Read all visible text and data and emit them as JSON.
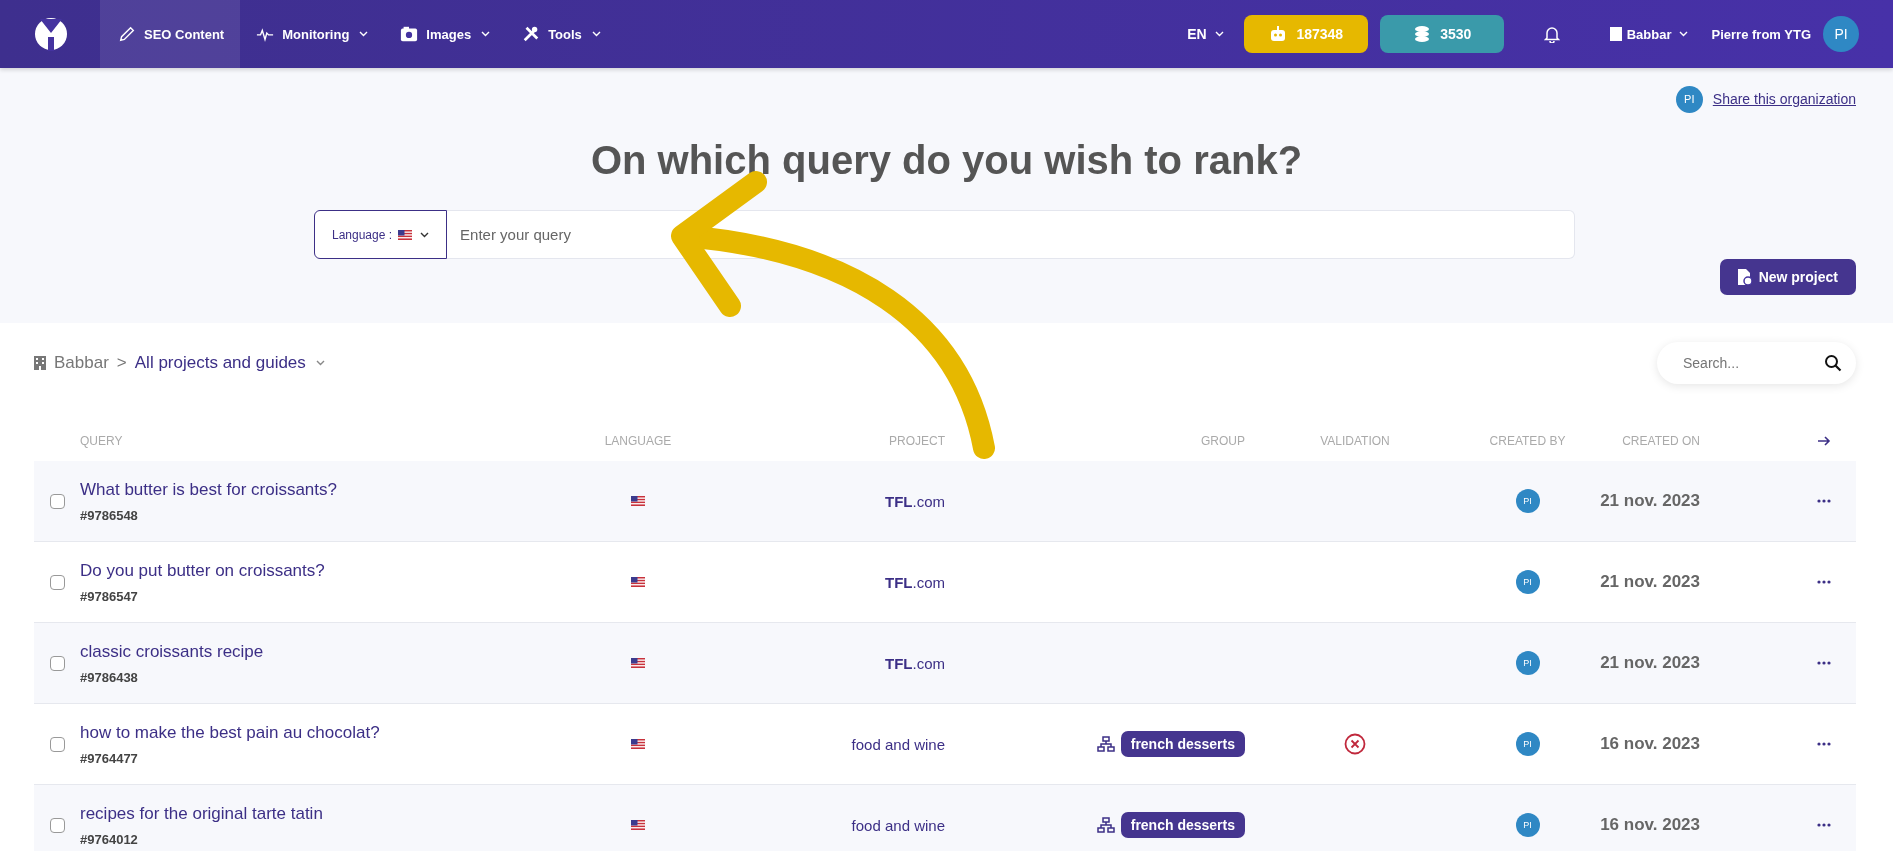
{
  "nav": {
    "items": [
      {
        "label": "SEO Content",
        "selected": true,
        "dropdown": false
      },
      {
        "label": "Monitoring",
        "selected": false,
        "dropdown": true
      },
      {
        "label": "Images",
        "selected": false,
        "dropdown": true
      },
      {
        "label": "Tools",
        "selected": false,
        "dropdown": true
      }
    ],
    "language": "EN",
    "credits": [
      {
        "value": "187348",
        "color": "#e6b800"
      },
      {
        "value": "3530",
        "color": "#3a9aaa"
      }
    ],
    "organization": "Babbar",
    "user": "Pierre from YTG",
    "avatar": "PI"
  },
  "share": {
    "avatar": "PI",
    "link": "Share this organization"
  },
  "heading": "On which query do you wish to rank?",
  "query_form": {
    "language_label": "Language :",
    "placeholder": "Enter your query"
  },
  "new_project": "New project",
  "breadcrumb": {
    "organization": "Babbar",
    "separator": ">",
    "current": "All projects and guides"
  },
  "search": {
    "placeholder": "Search..."
  },
  "table": {
    "columns": [
      "QUERY",
      "LANGUAGE",
      "PROJECT",
      "GROUP",
      "VALIDATION",
      "CREATED BY",
      "CREATED ON"
    ],
    "rows": [
      {
        "checked": false,
        "query": "What butter is best for croissants?",
        "id": "#9786548",
        "project": "**TFL**.com",
        "rejected": false,
        "creator": "PI",
        "date": "21 nov. 2023"
      },
      {
        "checked": false,
        "query": "Do you put butter on croissants?",
        "id": "#9786547",
        "project": "**TFL**.com",
        "rejected": false,
        "creator": "PI",
        "date": "21 nov. 2023"
      },
      {
        "checked": false,
        "query": "classic croissants recipe",
        "id": "#9786438",
        "project": "**TFL**.com",
        "rejected": false,
        "creator": "PI",
        "date": "21 nov. 2023"
      },
      {
        "checked": false,
        "query": "how to make the best pain au chocolat?",
        "id": "#9764477",
        "project": "food and wine",
        "group": "french desserts",
        "rejected": true,
        "creator": "PI",
        "date": "16 nov. 2023"
      },
      {
        "checked": false,
        "query": "recipes for the original tarte tatin",
        "id": "#9764012",
        "project": "food and wine",
        "group": "french desserts",
        "rejected": false,
        "creator": "PI",
        "date": "16 nov. 2023"
      }
    ]
  }
}
